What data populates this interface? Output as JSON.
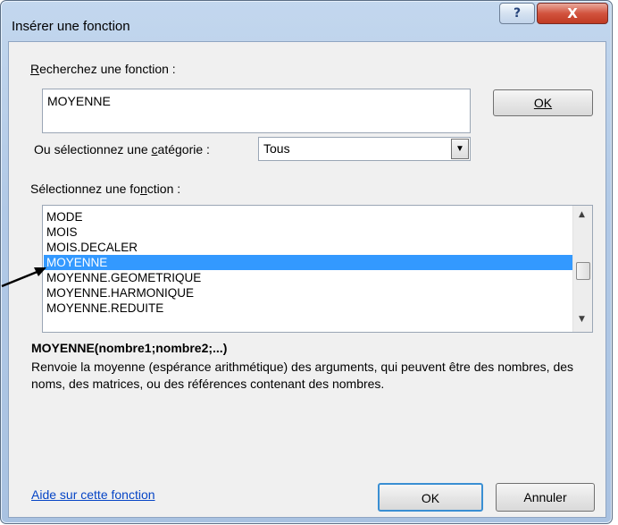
{
  "dialog": {
    "title": "Insérer une fonction",
    "help_button": "?",
    "close_button": "X"
  },
  "search": {
    "label_first": "R",
    "label_rest": "echerchez une fonction :",
    "value": "MOYENNE",
    "ok_label": "OK"
  },
  "category": {
    "label_before": "Ou sélectionnez une ",
    "label_underlined": "c",
    "label_after": "atégorie :",
    "selected": "Tous"
  },
  "function_list": {
    "label_before": "Sélectionnez une fo",
    "label_underlined": "n",
    "label_after": "ction :",
    "items": [
      {
        "name": "MODE",
        "selected": false
      },
      {
        "name": "MOIS",
        "selected": false
      },
      {
        "name": "MOIS.DECALER",
        "selected": false
      },
      {
        "name": "MOYENNE",
        "selected": true
      },
      {
        "name": "MOYENNE.GEOMETRIQUE",
        "selected": false
      },
      {
        "name": "MOYENNE.HARMONIQUE",
        "selected": false
      },
      {
        "name": "MOYENNE.REDUITE",
        "selected": false
      }
    ]
  },
  "details": {
    "syntax": "MOYENNE(nombre1;nombre2;...)",
    "description": "Renvoie la moyenne (espérance arithmétique) des arguments, qui peuvent être des nombres, des noms, des matrices, ou des références contenant des nombres."
  },
  "footer": {
    "help_link": "Aide sur cette fonction",
    "ok_label": "OK",
    "cancel_label": "Annuler"
  },
  "colors": {
    "selection": "#3399ff",
    "link": "#0645c6",
    "close_button": "#c03a22"
  }
}
